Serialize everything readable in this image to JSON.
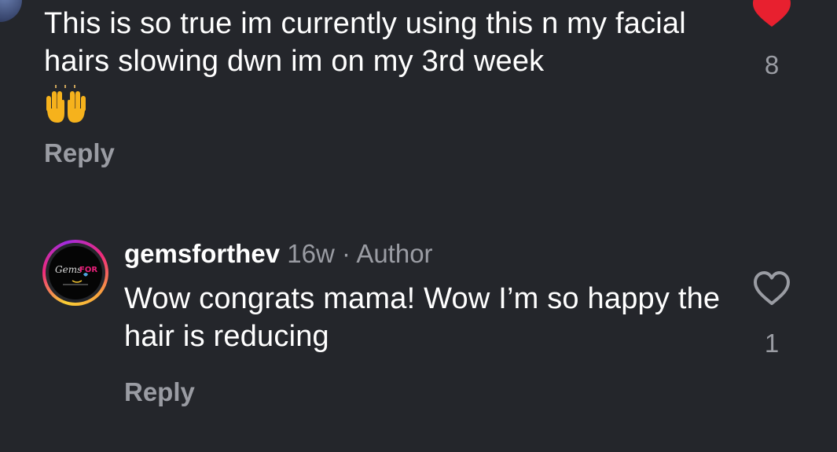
{
  "comments": [
    {
      "text": "This is so true im currently using this n my facial hairs slowing dwn im on my 3rd week",
      "emoji": "🙌",
      "reply_label": "Reply",
      "like_count": "8",
      "liked": true,
      "like_color": "#e8202f"
    },
    {
      "username": "gemsforthev",
      "age": "16w",
      "separator": "·",
      "badge": "Author",
      "text": "Wow congrats mama! Wow I’m so happy the hair is reducing",
      "reply_label": "Reply",
      "like_count": "1",
      "liked": false,
      "avatar_logo": "GemsFOR"
    }
  ],
  "colors": {
    "background": "#24262b",
    "text": "#ffffff",
    "muted": "#9a9ca3",
    "like": "#e8202f"
  },
  "icons": {
    "like_filled": "heart-filled-icon",
    "like_outline": "heart-outline-icon",
    "emoji": "raising-hands-emoji"
  }
}
